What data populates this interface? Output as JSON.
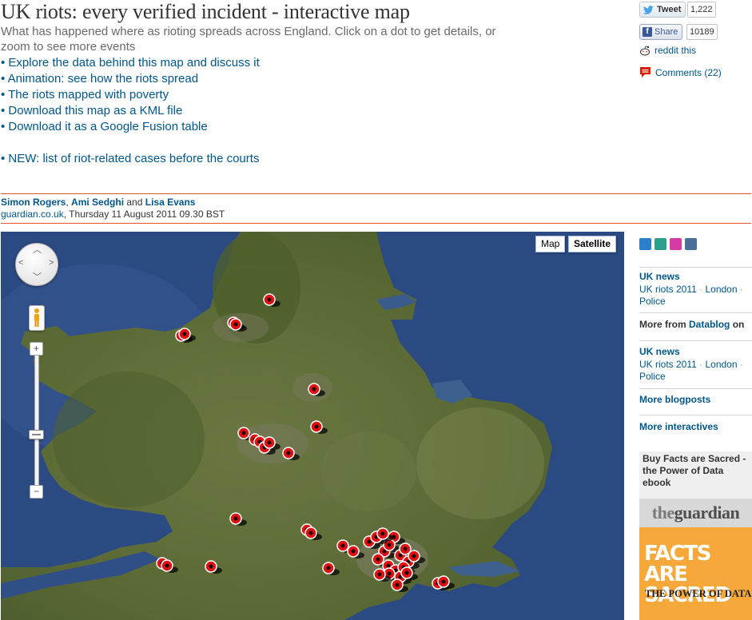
{
  "article": {
    "headline": "UK riots: every verified incident - interactive map",
    "standfirst": "What has happened where as rioting spreads across England. Click on a dot to get details, or zoom to see more events",
    "links": [
      "• Explore the data behind this map and discuss it",
      "• Animation: see how the riots spread",
      "• The riots mapped with poverty",
      "• Download this map as a KML file",
      "• Download it as a Google Fusion table",
      "",
      "• NEW: list of riot-related cases before the courts"
    ]
  },
  "share": {
    "tweet_label": "Tweet",
    "tweet_count": "1,222",
    "fb_label": "Share",
    "fb_count": "10189",
    "reddit_label": "reddit this",
    "comments_label": "Comments (22)"
  },
  "byline": {
    "author1": "Simon Rogers",
    "sep1": ", ",
    "author2": "Ami Sedghi",
    "and": " and ",
    "author3": "Lisa Evans",
    "source": "guardian.co.uk",
    "date": ", Thursday 11 August 2011 09.30 BST"
  },
  "map": {
    "type_map_label": "Map",
    "type_satellite_label": "Satellite",
    "zoom_in_label": "+",
    "zoom_minus_mid": "−",
    "zoom_out_label": "−",
    "marker_color": "#e01010",
    "sea_color": "#2c4a82",
    "land_color": "#5f6b3a"
  },
  "sidebar": {
    "section1_title": "UK news",
    "section1_links": [
      "UK riots 2011",
      "London",
      "Police"
    ],
    "more_from_label": "More from",
    "more_from_link": "Datablog",
    "more_from_on": " on",
    "section2_title": "UK news",
    "section2_links": [
      "UK riots 2011",
      "London",
      "Police"
    ],
    "more_blogposts": "More blogposts",
    "more_interactives": "More interactives",
    "promo_text": "Buy Facts are Sacred - the Power of Data ebook",
    "logo_the": "the",
    "logo_guardian": "guardian",
    "cover_title": "FACTS ARE SACRED",
    "cover_subtitle": "THE POWER OF DATA"
  }
}
